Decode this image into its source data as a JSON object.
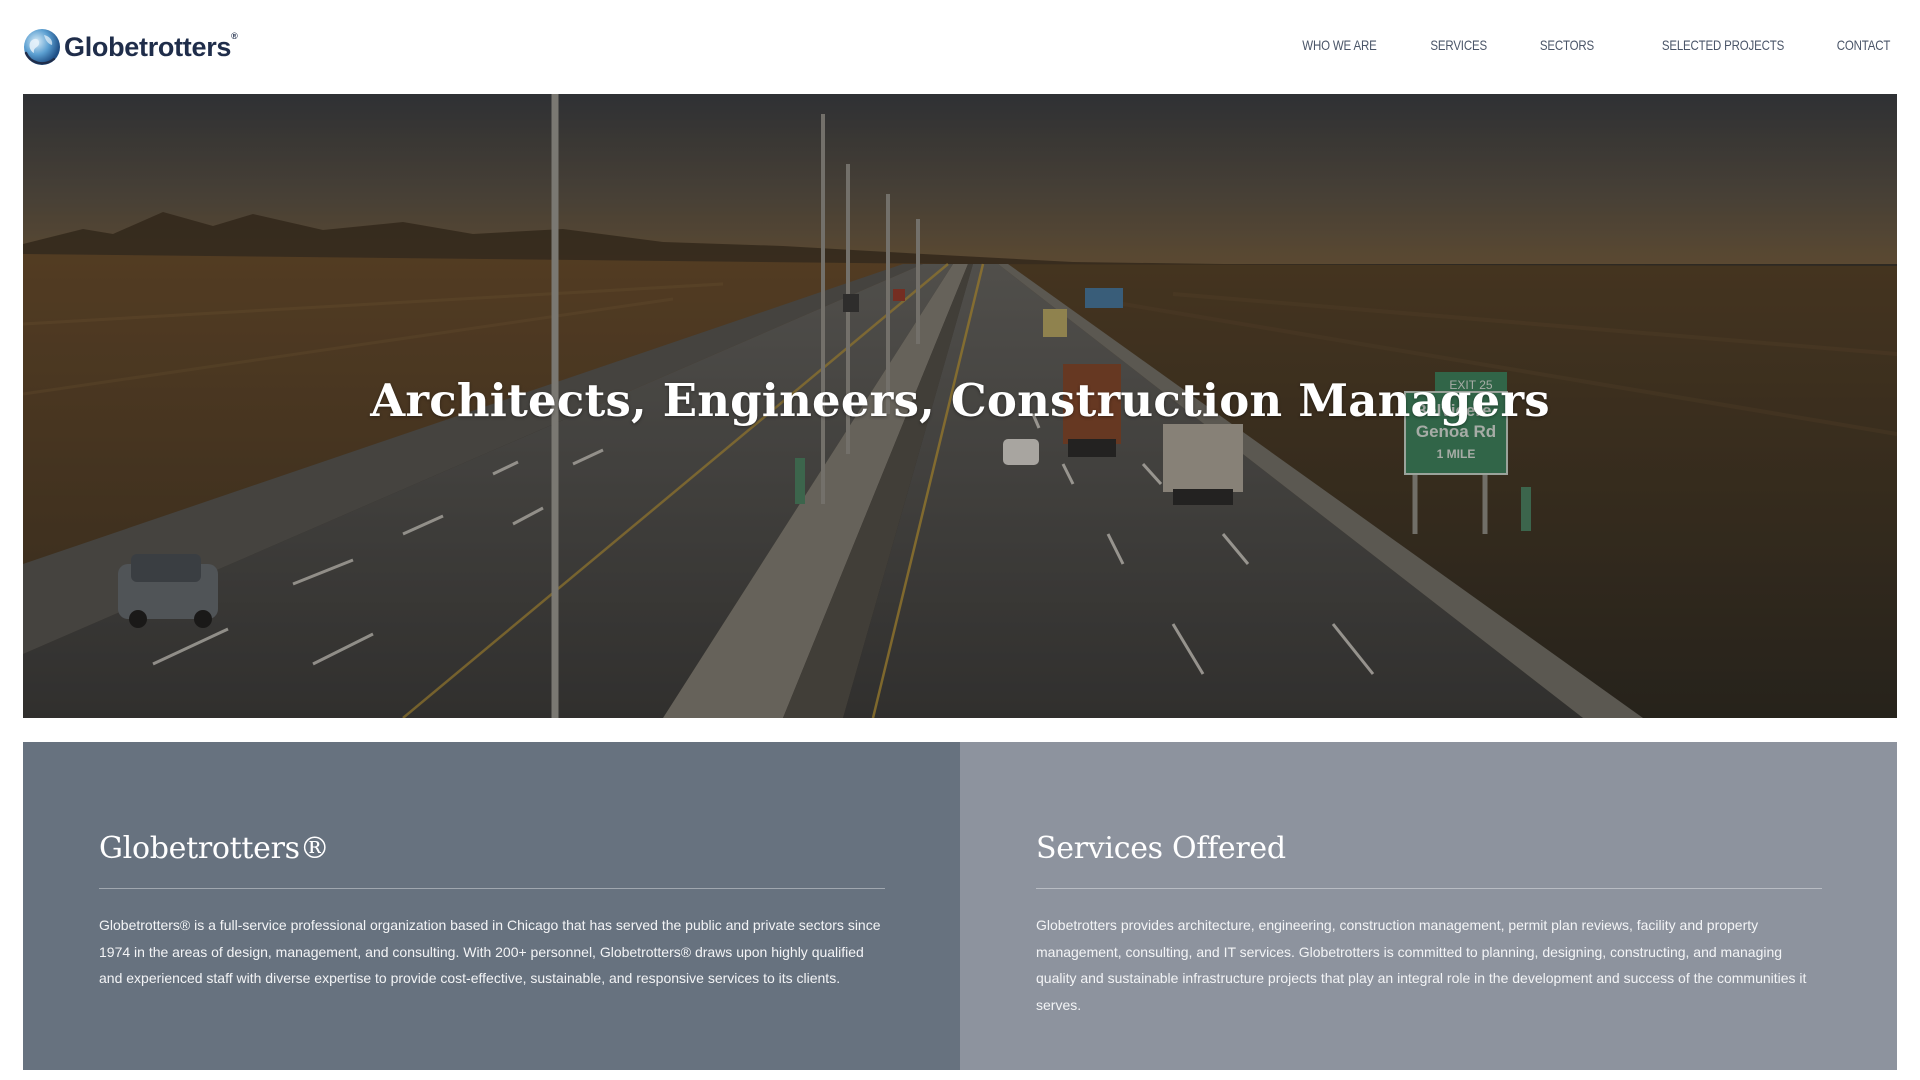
{
  "header": {
    "logo": {
      "text": "Globetrotters",
      "registered": "®",
      "icon": "globe-icon"
    },
    "nav": [
      {
        "label": "WHO WE ARE"
      },
      {
        "label": "SERVICES"
      },
      {
        "label": "SECTORS"
      },
      {
        "label": "SELECTED PROJECTS"
      },
      {
        "label": "CONTACT"
      }
    ]
  },
  "hero": {
    "title": "Architects, Engineers, Construction Managers",
    "image": "highway-aerial-photo",
    "sign": {
      "exit": "EXIT 25",
      "line1": "Belvidere-",
      "line2": "Genoa Rd",
      "line3": "1 MILE"
    }
  },
  "panels": [
    {
      "title": "Globetrotters®",
      "text": "Globetrotters® is a full-service professional organization based in Chicago that has served the public and private sectors since 1974 in the areas of design, management, and consulting. With 200+ personnel, Globetrotters® draws upon highly qualified and experienced staff with diverse expertise to provide cost-effective, sustainable, and responsive services to its clients.",
      "color": "#67727f"
    },
    {
      "title": "Services Offered",
      "text": "Globetrotters provides architecture, engineering, construction management, permit plan reviews, facility and property management, consulting, and IT services. Globetrotters is committed to planning, designing, constructing, and managing quality and sustainable infrastructure projects that play an integral role in the development and success of the communities it serves.",
      "color": "#8d939e"
    }
  ]
}
